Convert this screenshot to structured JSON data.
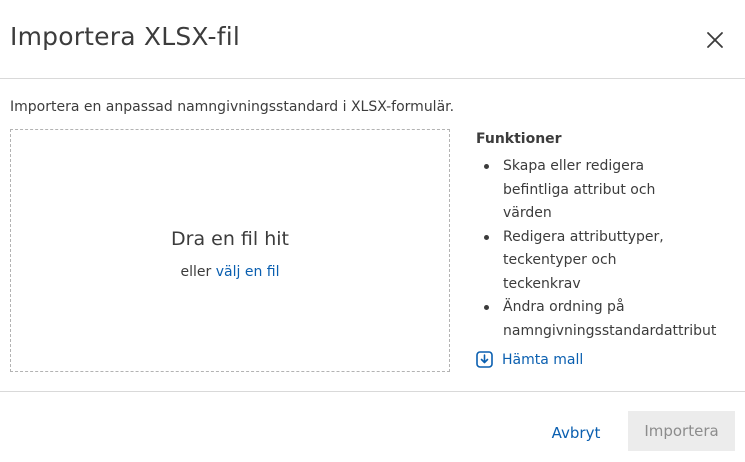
{
  "dialog": {
    "title": "Importera XLSX-fil",
    "description": "Importera en anpassad namngivningsstandard i XLSX-formulär.",
    "close_icon": "close-icon"
  },
  "dropzone": {
    "title": "Dra en fil hit",
    "prefix": "eller",
    "link": "välj en fil"
  },
  "features": {
    "heading": "Funktioner",
    "items": [
      [
        "Skapa eller redigera",
        "befintliga attribut och",
        "värden"
      ],
      [
        "Redigera attributtyper,",
        "teckentyper och",
        "teckenkrav"
      ],
      [
        "Ändra ordning på",
        "namngivningsstandardattribut"
      ]
    ],
    "download_label": "Hämta mall",
    "download_icon": "download-icon"
  },
  "footer": {
    "cancel_label": "Avbryt",
    "import_label": "Importera"
  },
  "colors": {
    "link": "#0a5fb0",
    "text": "#3c3c3c",
    "disabled_bg": "#ececec",
    "disabled_text": "#8c8c8c",
    "divider": "#d9d9d9"
  }
}
